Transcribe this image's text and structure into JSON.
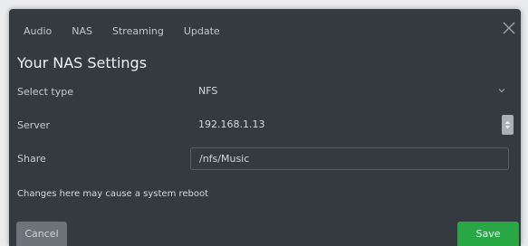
{
  "tabs": [
    {
      "label": "Audio"
    },
    {
      "label": "NAS"
    },
    {
      "label": "Streaming"
    },
    {
      "label": "Update"
    }
  ],
  "dialog": {
    "title": "Your NAS Settings",
    "close_icon": "close-icon"
  },
  "form": {
    "type_label": "Select type",
    "type_value": "NFS",
    "server_label": "Server",
    "server_value": "192.168.1.13",
    "share_label": "Share",
    "share_value": "/nfs/Music",
    "warning": "Changes here may cause a system reboot"
  },
  "buttons": {
    "cancel": "Cancel",
    "save": "Save"
  },
  "colors": {
    "dialog_bg": "#343a40",
    "save_green": "#28a745",
    "cancel_gray": "#6c737b"
  }
}
